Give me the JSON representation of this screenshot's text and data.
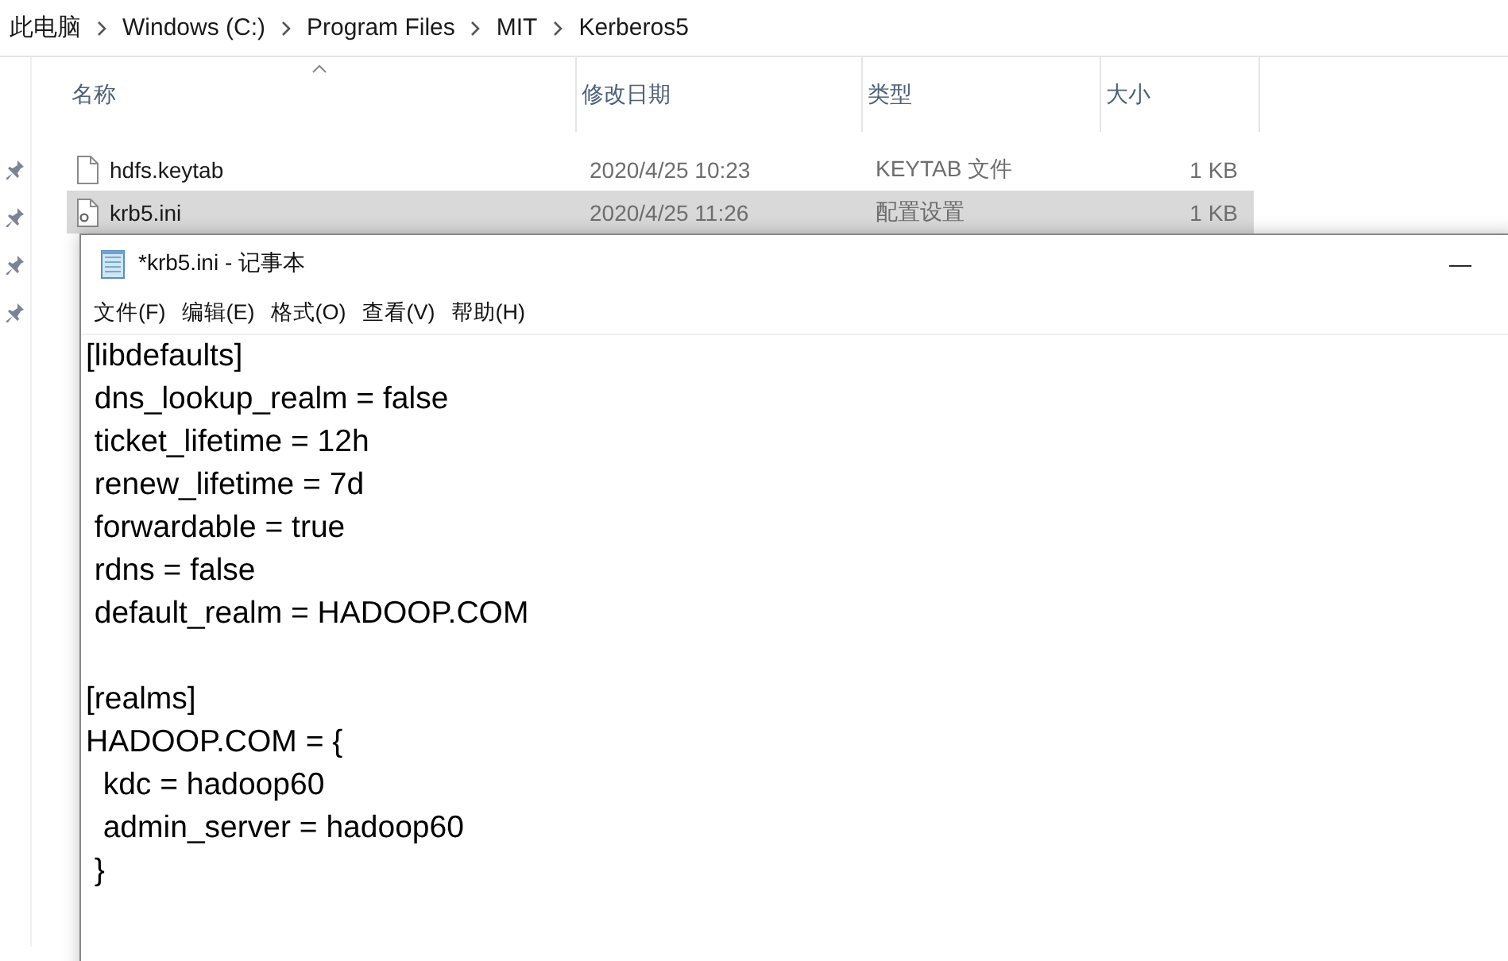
{
  "explorer": {
    "breadcrumb": [
      "此电脑",
      "Windows (C:)",
      "Program Files",
      "MIT",
      "Kerberos5"
    ],
    "columns": [
      {
        "label": "名称",
        "sorted": true
      },
      {
        "label": "修改日期",
        "sorted": false
      },
      {
        "label": "类型",
        "sorted": false
      },
      {
        "label": "大小",
        "sorted": false
      }
    ],
    "rows": [
      {
        "name": "hdfs.keytab",
        "kind": "file",
        "modified": "2020/4/25 10:23",
        "type": "KEYTAB 文件",
        "size": "1 KB",
        "selected": false
      },
      {
        "name": "krb5.ini",
        "kind": "settings",
        "modified": "2020/4/25 11:26",
        "type": "配置设置",
        "size": "1 KB",
        "selected": true
      }
    ]
  },
  "notepad": {
    "title": "*krb5.ini - 记事本",
    "minimize": "—",
    "menu": [
      "文件(F)",
      "编辑(E)",
      "格式(O)",
      "查看(V)",
      "帮助(H)"
    ],
    "text": "[libdefaults]\n dns_lookup_realm = false\n ticket_lifetime = 12h\n renew_lifetime = 7d\n forwardable = true\n rdns = false\n default_realm = HADOOP.COM\n\n[realms]\nHADOOP.COM = {\n  kdc = hadoop60\n  admin_server = hadoop60\n }"
  }
}
